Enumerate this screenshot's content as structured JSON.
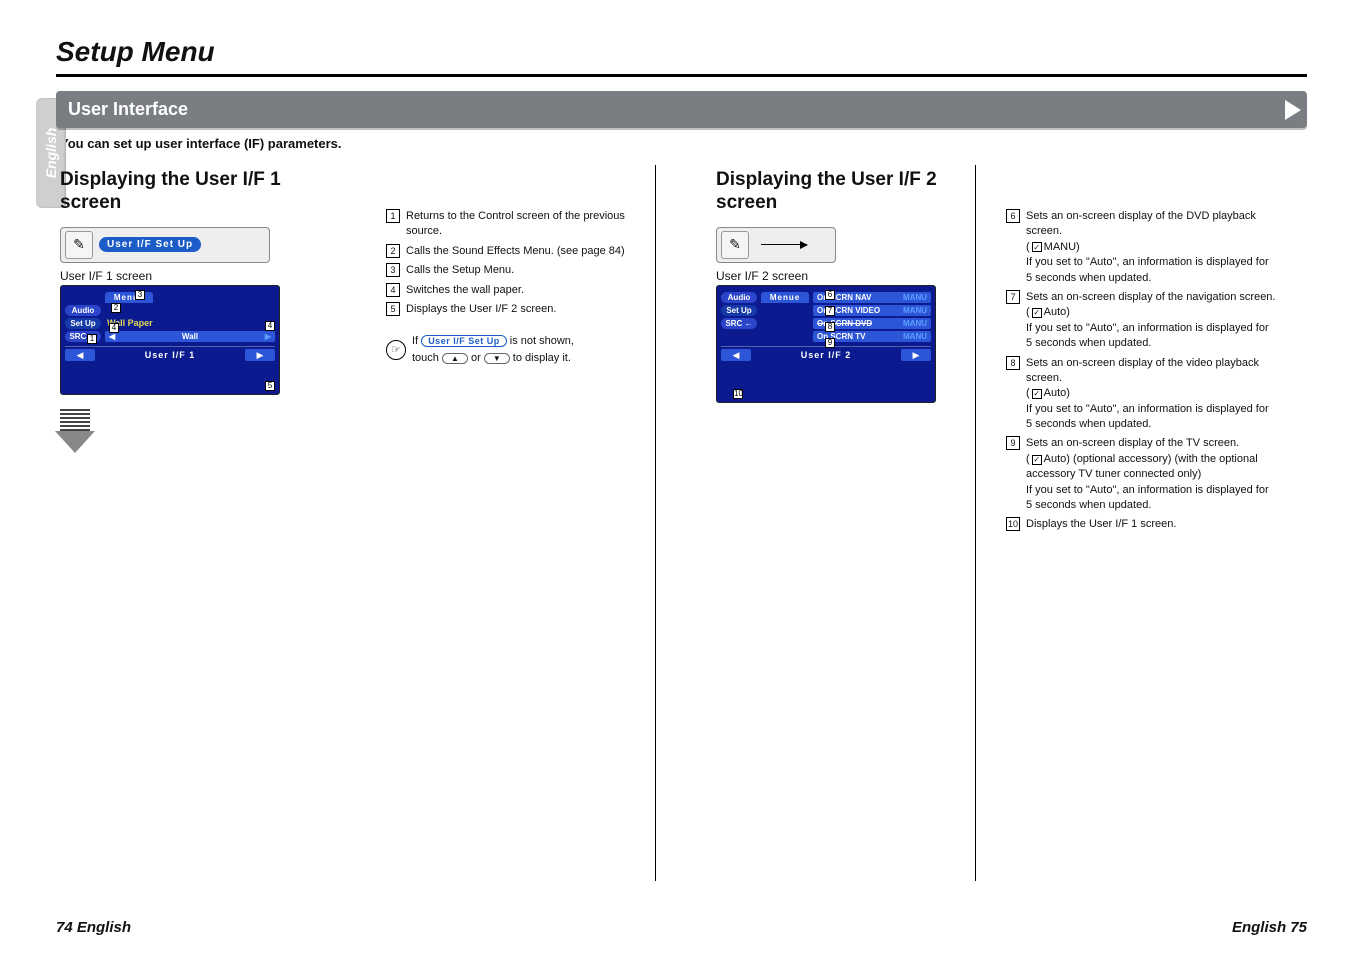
{
  "page": {
    "title": "Setup Menu",
    "side_tab": "English",
    "footer_left": "74 English",
    "footer_right": "English 75"
  },
  "section": {
    "title": "User Interface",
    "intro": "You can set up user interface (IF) parameters."
  },
  "left": {
    "heading": "Displaying the User I/F 1 screen",
    "strip_btn": "User I/F Set Up",
    "caption": "User I/F 1 screen",
    "device": {
      "menue": "Menue",
      "audio": "Audio",
      "setup": "Set Up",
      "src": "SRC",
      "wallpaper_label": "Wall Paper",
      "wallpaper_val": "Wall",
      "footer_title": "User I/F 1"
    }
  },
  "legend1": [
    {
      "n": "1",
      "t": "Returns to the Control screen of the previous source."
    },
    {
      "n": "2",
      "t": "Calls the Sound Effects Menu. (see page 84)"
    },
    {
      "n": "3",
      "t": "Calls the Setup Menu."
    },
    {
      "n": "4",
      "t": "Switches the wall paper."
    },
    {
      "n": "5",
      "t": "Displays the User I/F 2 screen."
    }
  ],
  "note": {
    "if": "If",
    "btn": "User I/F Set Up",
    "t1": "is not shown,",
    "t2a": "touch",
    "t2b": "or",
    "t2c": "to display it.",
    "up": "▲",
    "down": "▼"
  },
  "right": {
    "heading": "Displaying the User I/F 2 screen",
    "caption": "User I/F 2 screen",
    "device": {
      "menue": "Menue",
      "audio": "Audio",
      "setup": "Set Up",
      "src": "SRC",
      "rows": [
        {
          "l": "On SCRN NAV",
          "r": "MANU"
        },
        {
          "l": "On SCRN VIDEO",
          "r": "MANU"
        },
        {
          "l": "On SCRN DVD",
          "r": "MANU"
        },
        {
          "l": "On SCRN TV",
          "r": "MANU"
        }
      ],
      "footer_title": "User I/F 2"
    }
  },
  "legend2": [
    {
      "n": "6",
      "main": "Sets an on-screen display of the DVD playback screen.",
      "chk": "MANU",
      "sub": "If you set to \"Auto\", an information is displayed for 5 seconds when updated."
    },
    {
      "n": "7",
      "main": "Sets an on-screen display of the navigation screen.",
      "chk": "Auto",
      "sub": "If you set to \"Auto\", an information is displayed for 5 seconds when updated."
    },
    {
      "n": "8",
      "main": "Sets an on-screen display of the video playback screen.",
      "chk": "Auto",
      "sub": "If you set to \"Auto\", an information is displayed for 5 seconds when updated."
    },
    {
      "n": "9",
      "main": "Sets an on-screen display of the TV screen.",
      "chk": "Auto",
      "extra": "(optional accessory) (with the optional accessory TV tuner connected only)",
      "sub": "If you set to \"Auto\", an information is displayed for 5 seconds when updated."
    },
    {
      "n": "10",
      "main": "Displays the User I/F 1 screen."
    }
  ]
}
